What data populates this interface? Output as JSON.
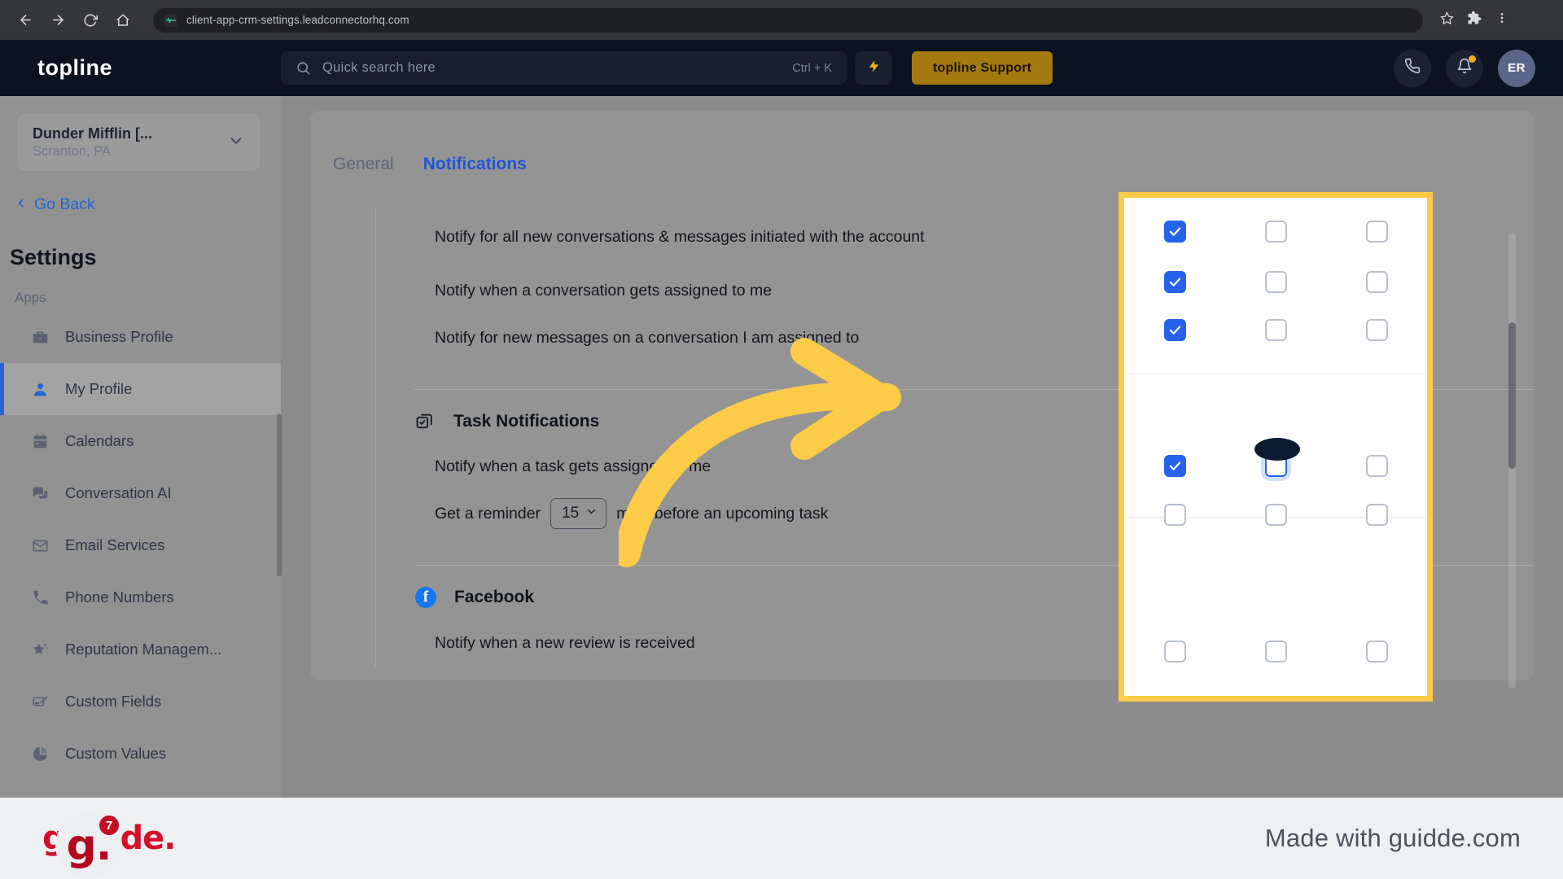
{
  "browser": {
    "url": "client-app-crm-settings.leadconnectorhq.com",
    "back_icon": "back-arrow-icon",
    "forward_icon": "forward-arrow-icon",
    "reload_icon": "reload-icon",
    "home_icon": "home-icon",
    "bookmark_icon": "star-icon",
    "extensions_icon": "puzzle-icon",
    "menu_icon": "kebab-menu-icon"
  },
  "appbar": {
    "brand": "topline",
    "search_placeholder": "Quick search here",
    "search_shortcut": "Ctrl + K",
    "support_label": "topline Support",
    "avatar_initials": "ER",
    "accent_gold": "#a4790f",
    "bg": "#0b1220"
  },
  "sidebar": {
    "location_name": "Dunder Mifflin [...",
    "location_sub": "Scranton, PA",
    "go_back": "Go Back",
    "title": "Settings",
    "group_label": "Apps",
    "items": [
      {
        "label": "Business Profile",
        "icon": "briefcase-icon",
        "active": false
      },
      {
        "label": "My Profile",
        "icon": "person-icon",
        "active": true
      },
      {
        "label": "Calendars",
        "icon": "calendar-icon",
        "active": false
      },
      {
        "label": "Conversation AI",
        "icon": "chat-bubbles-icon",
        "active": false
      },
      {
        "label": "Email Services",
        "icon": "envelope-icon",
        "active": false
      },
      {
        "label": "Phone Numbers",
        "icon": "phone-icon",
        "active": false
      },
      {
        "label": "Reputation Managem...",
        "icon": "star-sparkle-icon",
        "active": false
      },
      {
        "label": "Custom Fields",
        "icon": "form-edit-icon",
        "active": false
      },
      {
        "label": "Custom Values",
        "icon": "pie-chart-icon",
        "active": false
      }
    ]
  },
  "main": {
    "tabs": [
      {
        "label": "General",
        "active": false
      },
      {
        "label": "Notifications",
        "active": true
      }
    ],
    "rows": [
      {
        "text": "Notify for all new conversations & messages initiated with the account"
      },
      {
        "text": "Notify when a conversation gets assigned to me"
      },
      {
        "text": "Notify for new messages on a conversation I am assigned to"
      }
    ],
    "task_section": {
      "icon": "task-copy-icon",
      "title": "Task Notifications",
      "row_assigned": "Notify when a task gets assigned to me",
      "reminder_prefix": "Get a reminder",
      "reminder_value": "15",
      "reminder_suffix": "mins before an upcoming task"
    },
    "facebook_section": {
      "icon": "facebook-icon",
      "title": "Facebook",
      "row_review": "Notify when a new review is received",
      "brand_color": "#1877f2"
    }
  },
  "highlight": {
    "border_color": "#fccb47",
    "columns": [
      "column-1",
      "column-2",
      "column-3"
    ],
    "rows": [
      {
        "name": "row-all-conversations",
        "states": [
          "checked",
          "unchecked",
          "unchecked"
        ]
      },
      {
        "name": "row-conversation-assigned",
        "states": [
          "checked",
          "unchecked",
          "unchecked"
        ]
      },
      {
        "name": "row-new-messages",
        "states": [
          "checked",
          "unchecked",
          "unchecked"
        ]
      },
      {
        "name": "row-task-assigned",
        "states": [
          "checked",
          "focused",
          "unchecked"
        ]
      },
      {
        "name": "row-task-reminder",
        "states": [
          "unchecked",
          "unchecked",
          "unchecked"
        ]
      },
      {
        "name": "row-facebook-review",
        "states": [
          "unchecked",
          "unchecked",
          "unchecked"
        ]
      }
    ]
  },
  "annotation": {
    "arrow": "curved-arrow-right",
    "arrow_color": "#fccb47",
    "cursor": "mouse-pointer"
  },
  "guidde": {
    "widget_letter": "g.",
    "badge_count": "7",
    "footer_logo": "guidde.",
    "footer_text": "Made with guidde.com",
    "brand_red": "#d3102a"
  }
}
